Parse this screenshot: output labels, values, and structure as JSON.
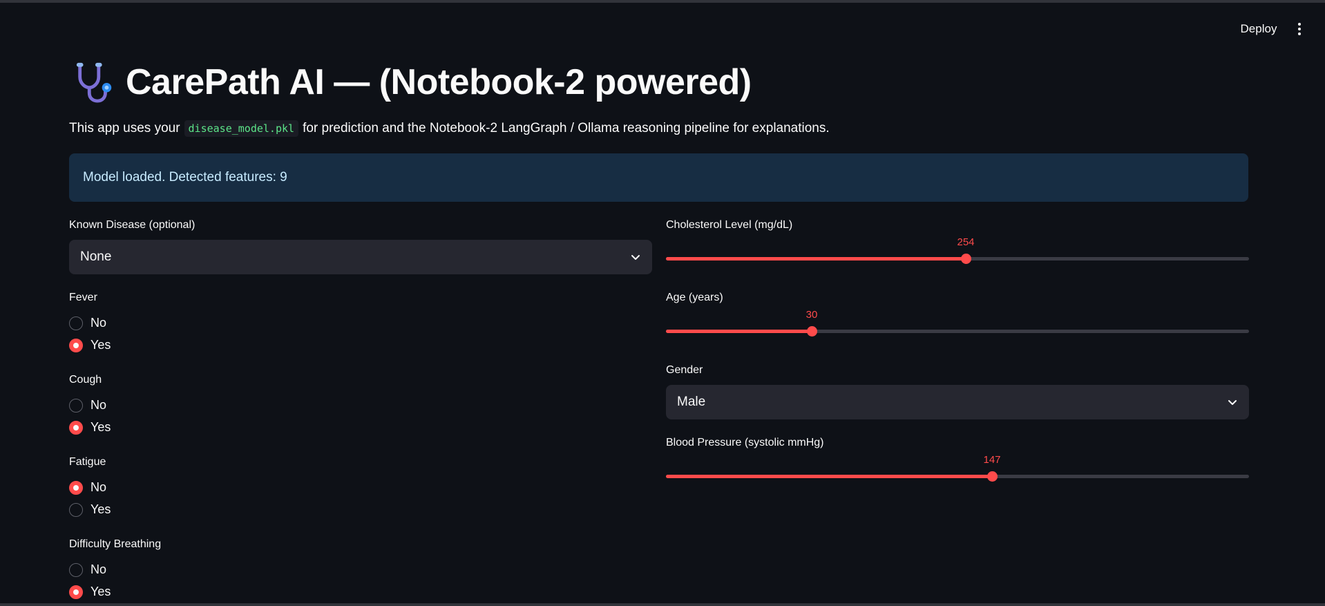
{
  "header": {
    "deploy_label": "Deploy",
    "menu_icon": "kebab-menu-icon"
  },
  "app": {
    "title_icon": "stethoscope-icon",
    "title": "CarePath AI — (Notebook-2 powered)",
    "intro_prefix": "This app uses your",
    "intro_code": "disease_model.pkl",
    "intro_suffix": "for prediction and the Notebook-2 LangGraph / Ollama reasoning pipeline for explanations.",
    "info_message": "Model loaded. Detected features: 9"
  },
  "left": {
    "known_disease": {
      "label": "Known Disease (optional)",
      "value": "None"
    },
    "fever": {
      "label": "Fever",
      "options": [
        "No",
        "Yes"
      ],
      "selected": "Yes"
    },
    "cough": {
      "label": "Cough",
      "options": [
        "No",
        "Yes"
      ],
      "selected": "Yes"
    },
    "fatigue": {
      "label": "Fatigue",
      "options": [
        "No",
        "Yes"
      ],
      "selected": "No"
    },
    "difficulty_breathing": {
      "label": "Difficulty Breathing",
      "options": [
        "No",
        "Yes"
      ],
      "selected": "Yes"
    }
  },
  "right": {
    "cholesterol": {
      "label": "Cholesterol Level (mg/dL)",
      "value": 254,
      "fraction": 0.514
    },
    "age": {
      "label": "Age (years)",
      "value": 30,
      "fraction": 0.25
    },
    "gender": {
      "label": "Gender",
      "value": "Male"
    },
    "blood_pressure": {
      "label": "Blood Pressure (systolic mmHg)",
      "value": 147,
      "fraction": 0.559
    }
  },
  "colors": {
    "background": "#0e1117",
    "accent": "#ff4b4b",
    "info_bg": "#172d43",
    "info_text": "#c7ebff",
    "widget_bg": "#262730",
    "code_text": "#5ce488"
  }
}
